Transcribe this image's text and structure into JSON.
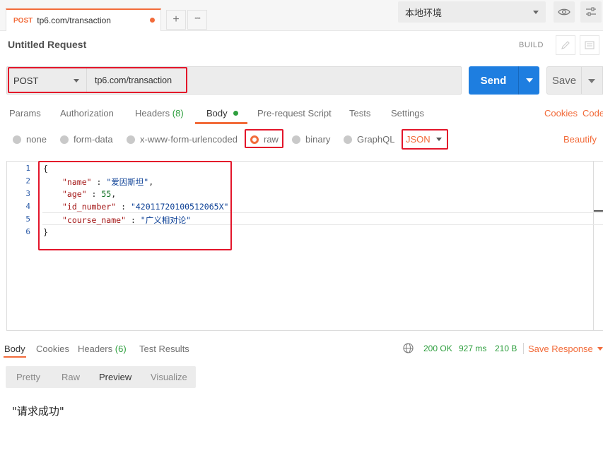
{
  "tab": {
    "method": "POST",
    "url": "tp6.com/transaction",
    "add_label": "+",
    "more_label": "°°°"
  },
  "environment": {
    "selected": "本地环境"
  },
  "request": {
    "title": "Untitled Request",
    "build_label": "BUILD",
    "method": "POST",
    "url": "tp6.com/transaction",
    "send_label": "Send",
    "save_label": "Save"
  },
  "request_tabs": {
    "params": "Params",
    "authorization": "Authorization",
    "headers": "Headers",
    "headers_count": "(8)",
    "body": "Body",
    "prerequest": "Pre-request Script",
    "tests": "Tests",
    "settings": "Settings",
    "cookies": "Cookies",
    "code": "Code"
  },
  "body_types": {
    "none": "none",
    "form_data": "form-data",
    "urlencoded": "x-www-form-urlencoded",
    "raw": "raw",
    "binary": "binary",
    "graphql": "GraphQL",
    "format": "JSON",
    "beautify": "Beautify",
    "selected": "raw"
  },
  "editor": {
    "line_numbers": [
      "1",
      "2",
      "3",
      "4",
      "5",
      "6"
    ],
    "line1": "{",
    "name_key": "\"name\"",
    "name_sep": " : ",
    "name_val": "\"爱因斯坦\"",
    "name_end": ",",
    "age_key": "\"age\"",
    "age_sep": " : ",
    "age_val": "55",
    "age_end": ",",
    "id_key": "\"id_number\"",
    "id_sep": " : ",
    "id_val": "\"42011720100512065X\"",
    "id_end": ",",
    "course_key": "\"course_name\"",
    "course_sep": " : ",
    "course_val": "\"广义相对论\"",
    "line6": "}"
  },
  "response": {
    "tabs": {
      "body": "Body",
      "cookies": "Cookies",
      "headers": "Headers",
      "headers_count": "(6)",
      "test_results": "Test Results"
    },
    "status": "200 OK",
    "time": "927 ms",
    "size": "210 B",
    "save_response": "Save Response",
    "views": {
      "pretty": "Pretty",
      "raw": "Raw",
      "preview": "Preview",
      "visualize": "Visualize",
      "selected": "Preview"
    },
    "text": "\"请求成功\""
  },
  "colors": {
    "accent": "#f26b3a",
    "send": "#1e7ee0",
    "success": "#2e9f3e",
    "highlight_box": "#e3152a"
  }
}
